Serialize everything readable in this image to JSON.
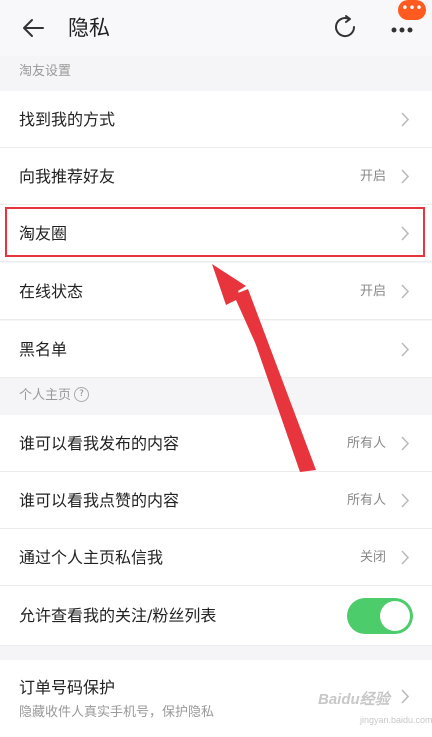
{
  "header": {
    "title": "隐私",
    "badge": "•••"
  },
  "sections": [
    {
      "label": "淘友设置"
    },
    {
      "label": "个人主页"
    }
  ],
  "rows": [
    {
      "label": "找到我的方式",
      "value": ""
    },
    {
      "label": "向我推荐好友",
      "value": "开启"
    },
    {
      "label": "淘友圈",
      "value": ""
    },
    {
      "label": "在线状态",
      "value": "开启"
    },
    {
      "label": "黑名单",
      "value": ""
    },
    {
      "label": "谁可以看我发布的内容",
      "value": "所有人"
    },
    {
      "label": "谁可以看我点赞的内容",
      "value": "所有人"
    },
    {
      "label": "通过个人主页私信我",
      "value": "关闭"
    },
    {
      "label": "允许查看我的关注/粉丝列表",
      "toggle_on": true
    }
  ],
  "order": {
    "label": "订单号码保护",
    "sub": "隐藏收件人真实手机号，保护隐私"
  },
  "watermark": {
    "brand": "Baidu经验",
    "sub": "jingyan.baidu.com"
  },
  "colors": {
    "toggle": "#4ccc6a",
    "highlight": "#e8343c",
    "badge": "#ff5a1f"
  }
}
